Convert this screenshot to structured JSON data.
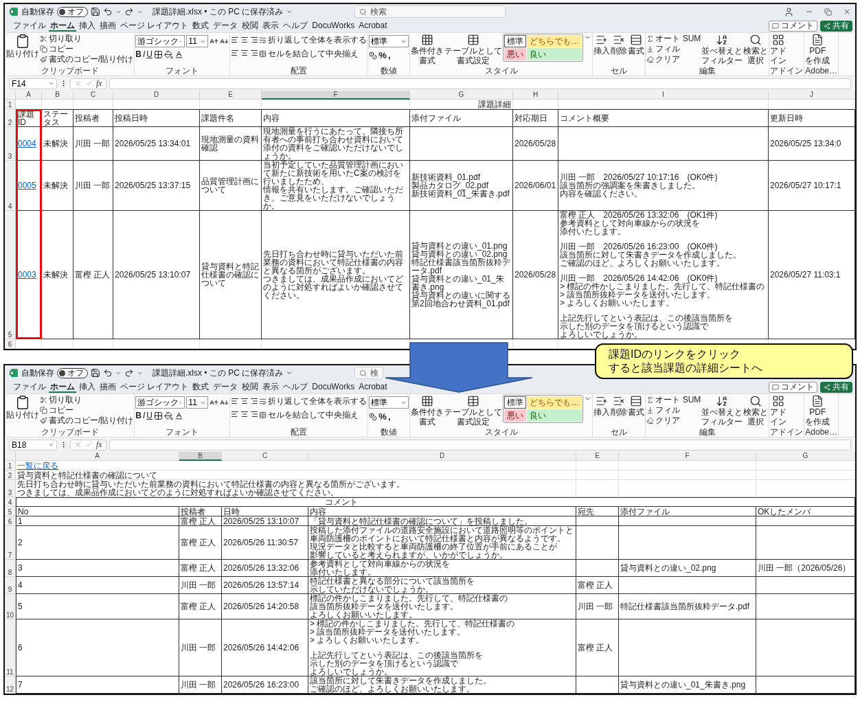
{
  "windows": [
    {
      "titlebar": {
        "autosave": "自動保存",
        "toggle": {
          "label": "オフ",
          "on": false
        },
        "filename": "課題詳細.xlsx • この PC に保存済み",
        "search": "検索",
        "controls_visible": true
      },
      "tabs": [
        {
          "label": "ファイル",
          "selected": false
        },
        {
          "label": "ホーム",
          "selected": true
        },
        {
          "label": "挿入",
          "selected": false
        },
        {
          "label": "描画",
          "selected": false
        },
        {
          "label": "ページ レイアウト",
          "selected": false
        },
        {
          "label": "数式",
          "selected": false
        },
        {
          "label": "データ",
          "selected": false
        },
        {
          "label": "校閲",
          "selected": false
        },
        {
          "label": "表示",
          "selected": false
        },
        {
          "label": "ヘルプ",
          "selected": false
        },
        {
          "label": "DocuWorks",
          "selected": false
        },
        {
          "label": "Acrobat",
          "selected": false
        }
      ],
      "tab_buttons": {
        "comment": "コメント",
        "share": "共有"
      },
      "ribbon": [
        {
          "kind": "clipboard",
          "label": "クリップボード",
          "paste": "貼り付け",
          "items": [
            "切り取り",
            "コピー",
            "書式のコピー/貼り付け"
          ]
        },
        {
          "kind": "font",
          "label": "フォント",
          "font": "游ゴシック",
          "size": "11",
          "styles": [
            "B",
            "I",
            "U"
          ]
        },
        {
          "kind": "align",
          "label": "配置",
          "items": [
            "折り返して全体を表示する",
            "セルを結合して中央揃え"
          ]
        },
        {
          "kind": "number",
          "label": "数値",
          "format": "標準",
          "symbols": [
            "%",
            ","
          ]
        },
        {
          "kind": "styles",
          "label": "スタイル",
          "buttons": [
            [
              "条件付き",
              "書式"
            ],
            [
              "テーブルとして",
              "書式設定"
            ]
          ],
          "cells": [
            {
              "text": "標準",
              "kind": "normal"
            },
            {
              "text": "どちらでも…",
              "kind": "neutral"
            },
            {
              "text": "悪い",
              "kind": "bad"
            },
            {
              "text": "良い",
              "kind": "good"
            }
          ]
        },
        {
          "kind": "cells",
          "label": "セル",
          "buttons": [
            [
              "挿入"
            ],
            [
              "削除"
            ],
            [
              "書式"
            ]
          ]
        },
        {
          "kind": "edit",
          "label": "編集",
          "items": [
            "オート SUM",
            "フィル",
            "クリア"
          ],
          "buttons": [
            [
              "並べ替えと",
              "フィルター"
            ],
            [
              "検索と",
              "選択"
            ]
          ]
        },
        {
          "kind": "addins",
          "label": "アドイン",
          "buttons": [
            [
              "アド",
              "イン"
            ]
          ]
        },
        {
          "kind": "pdf",
          "label": "Adobe…",
          "buttons": [
            [
              "PDF",
              "を作成"
            ]
          ]
        }
      ],
      "formula": {
        "name_box": "F14",
        "fx": "fx"
      },
      "sheet": {
        "kind": "list",
        "columns": [
          {
            "letter": "A",
            "selected": false
          },
          {
            "letter": "B",
            "selected": false
          },
          {
            "letter": "C",
            "selected": false
          },
          {
            "letter": "D",
            "selected": false
          },
          {
            "letter": "E",
            "selected": false
          },
          {
            "letter": "F",
            "selected": true
          },
          {
            "letter": "G",
            "selected": false
          },
          {
            "letter": "H",
            "selected": false
          },
          {
            "letter": "I",
            "selected": false
          },
          {
            "letter": "J",
            "selected": false
          }
        ],
        "rows": [
          {
            "num": "1",
            "kind": "caption",
            "cells": [
              {},
              {},
              {},
              {},
              {},
              {},
              {
                "text": "課題詳細"
              },
              {},
              {},
              {}
            ]
          },
          {
            "num": "2",
            "kind": "header",
            "cells": [
              {
                "text": "課題ID",
                "highlighted": true
              },
              {
                "text": "ステータス"
              },
              {
                "text": "投稿者"
              },
              {
                "text": "投稿日時"
              },
              {
                "text": "課題件名"
              },
              {
                "text": "内容"
              },
              {
                "text": "添付ファイル"
              },
              {
                "text": "対応期日"
              },
              {
                "text": "コメント概要"
              },
              {
                "text": "更新日時"
              }
            ]
          },
          {
            "num": "3",
            "kind": "data",
            "cells": [
              {
                "text": "0004",
                "kind": "link",
                "highlighted": true
              },
              {
                "text": "未解決"
              },
              {
                "text": "川田 一郎"
              },
              {
                "text": "2026/05/25 13:34:01"
              },
              {
                "text": "現地測量の資料確認"
              },
              {
                "lines": [
                  "現地測量を行うにあたって、隣接ち所有者への事前打ち合わせ資料において",
                  "添付の資料をご確認いただけないでしょうか。"
                ]
              },
              {},
              {
                "text": "2026/05/28"
              },
              {},
              {
                "text": "2026/05/25 13:34:0"
              }
            ]
          },
          {
            "num": "4",
            "kind": "data",
            "cells": [
              {
                "text": "0005",
                "kind": "link",
                "highlighted": true
              },
              {
                "text": "未解決"
              },
              {
                "text": "川田 一郎"
              },
              {
                "text": "2026/05/25 13:37:15"
              },
              {
                "text": "品質管理計画について"
              },
              {
                "lines": [
                  "当初予定していた品質管理計画において新たに新技術を用いたC案の検討を行いましたため、",
                  "情報を共有いたします。ご確認いただき、ご意見をいただけないでしょうか。"
                ]
              },
              {
                "lines": [
                  "新技術資料_01.pdf",
                  "製品カタログ_02.pdf",
                  "新技術資料_01_朱書き.pdf"
                ]
              },
              {
                "text": "2026/06/01"
              },
              {
                "lines": [
                  "川田 一郎　2026/05/27 10:17:16　(OK0件)",
                  "該当箇所の強調案を朱書きしました。",
                  "内容を確認ください。"
                ]
              },
              {
                "text": "2026/05/27 10:17:1"
              }
            ]
          },
          {
            "num": "5",
            "kind": "data",
            "cells": [
              {
                "text": "0003",
                "kind": "link",
                "highlighted": true
              },
              {
                "text": "未解決"
              },
              {
                "text": "富樫 正人"
              },
              {
                "text": "2026/05/25 13:10:07"
              },
              {
                "text": "貸与資料と特記仕様書の確認について"
              },
              {
                "lines": [
                  "先日打ち合わせ時に貸与いただいた前業務の資料において特記仕様書の内容と異なる箇所がございます。",
                  "つきましては、成果品作成においてどのように対処すればよいか確認させてください。"
                ]
              },
              {
                "lines": [
                  "貸与資料との違い_01.png",
                  "貸与資料との違い_02.png",
                  "特記仕様書該当箇所抜粋データ.pdf",
                  "貸与資料との違い_01_朱書き.png",
                  "貸与資料との違いに関する第2回地合わせ資料_01.pdf"
                ]
              },
              {
                "text": "2026/05/28"
              },
              {
                "paragraphs": [
                  [
                    "富樫 正人　2026/05/26 13:32:06　(OK1件)",
                    "参考資料として対向車線からの状況を",
                    "添付いたします。"
                  ],
                  [
                    "川田 一郎　2026/05/26 16:23:00　(OK0件)",
                    "該当箇所に対して朱書きデータを作成しました。",
                    "ご確認のほど、よろしくお願いいたします。"
                  ],
                  [
                    "川田 一郎　2026/05/26 14:42:06　(OK0件)",
                    "> 標記の件かしこまりました。先行して、特記仕様書の",
                    "> 該当箇所抜粋データを送付いたします。",
                    "> よろしくお願いいたします。"
                  ],
                  [
                    "上記先行してという表記は、この後該当箇所を",
                    "示した別のデータを頂けるという認識で",
                    "よろしいでしょうか。"
                  ]
                ]
              },
              {
                "text": "2026/05/27 11:03:1"
              }
            ]
          },
          {
            "num": "6",
            "kind": "plain",
            "cells": [
              {},
              {},
              {},
              {},
              {},
              {},
              {},
              {},
              {},
              {}
            ]
          }
        ]
      }
    },
    {
      "titlebar": {
        "autosave": "自動保存",
        "toggle": {
          "label": "オフ",
          "on": false
        },
        "filename": "課題詳細.xlsx • この PC に保存済み",
        "search": "検"
      },
      "tabs": [
        {
          "label": "ファイル",
          "selected": false
        },
        {
          "label": "ホーム",
          "selected": true
        },
        {
          "label": "挿入",
          "selected": false
        },
        {
          "label": "描画",
          "selected": false
        },
        {
          "label": "ページ レイアウト",
          "selected": false
        },
        {
          "label": "数式",
          "selected": false
        },
        {
          "label": "データ",
          "selected": false
        },
        {
          "label": "校閲",
          "selected": false
        },
        {
          "label": "表示",
          "selected": false
        },
        {
          "label": "ヘルプ",
          "selected": false
        },
        {
          "label": "DocuWorks",
          "selected": false
        },
        {
          "label": "Acrobat",
          "selected": false
        }
      ],
      "tab_buttons": {
        "comment": "コメント",
        "share": "共有"
      },
      "ribbon": [
        {
          "kind": "clipboard",
          "label": "クリップボード",
          "paste": "貼り付け",
          "items": [
            "切り取り",
            "コピー",
            "書式のコピー/貼り付け"
          ]
        },
        {
          "kind": "font",
          "label": "フォント",
          "font": "游ゴシック",
          "size": "11",
          "styles": [
            "B",
            "I",
            "U"
          ]
        },
        {
          "kind": "align",
          "label": "配置",
          "items": [
            "折り返して全体を表示する",
            "セルを結合して中央揃え"
          ]
        },
        {
          "kind": "number",
          "label": "数値",
          "format": "標準",
          "symbols": [
            "%",
            ","
          ]
        },
        {
          "kind": "styles",
          "label": "スタイル",
          "buttons": [
            [
              "条件付き",
              "書式"
            ],
            [
              "テーブルとして",
              "書式設定"
            ]
          ],
          "cells": [
            {
              "text": "標準",
              "kind": "normal"
            },
            {
              "text": "どちらでも…",
              "kind": "neutral"
            },
            {
              "text": "悪い",
              "kind": "bad"
            },
            {
              "text": "良い",
              "kind": "good"
            }
          ]
        },
        {
          "kind": "cells",
          "label": "セル",
          "buttons": [
            [
              "挿入"
            ],
            [
              "削除"
            ],
            [
              "書式"
            ]
          ]
        },
        {
          "kind": "edit",
          "label": "編集",
          "items": [
            "オート SUM",
            "フィル",
            "クリア"
          ],
          "buttons": [
            [
              "並べ替えと",
              "フィルター"
            ],
            [
              "検索と",
              "選択"
            ]
          ]
        },
        {
          "kind": "addins",
          "label": "アドイン",
          "buttons": [
            [
              "アド",
              "イン"
            ]
          ]
        },
        {
          "kind": "pdf",
          "label": "Adobe…",
          "buttons": [
            [
              "PDF",
              "を作成"
            ]
          ]
        }
      ],
      "formula": {
        "name_box": "B18",
        "fx": "fx"
      },
      "sheet": {
        "kind": "detail",
        "columns": [
          {
            "letter": "A",
            "selected": false
          },
          {
            "letter": "B",
            "selected": true
          },
          {
            "letter": "C",
            "selected": false
          },
          {
            "letter": "D",
            "selected": false
          },
          {
            "letter": "E",
            "selected": false
          },
          {
            "letter": "F",
            "selected": false
          },
          {
            "letter": "G",
            "selected": false
          }
        ],
        "rows": [
          {
            "num": "1",
            "kind": "plain",
            "cells": [
              {
                "text": "一覧に戻る",
                "kind": "link"
              },
              {
                "merged": true
              },
              {
                "merged": true
              },
              {
                "merged": true
              },
              {},
              {},
              {}
            ]
          },
          {
            "num": "2",
            "kind": "plain",
            "cells": [
              {
                "text": "貸与資料と特記仕様書の確認について"
              },
              {
                "merged": true
              },
              {
                "merged": true
              },
              {
                "merged": true
              },
              {},
              {},
              {}
            ]
          },
          {
            "num": "3",
            "kind": "plain",
            "cells": [
              {
                "lines": [
                  "先日打ち合わせ時に貸与いただいた前業務の資料において特記仕様書の内容と異なる箇所がございます。",
                  "つきましては、成果品作成においてどのように対処すればよいか確認させてください。"
                ]
              },
              {
                "merged": true
              },
              {
                "merged": true
              },
              {
                "merged": true
              },
              {},
              {},
              {}
            ]
          },
          {
            "num": "4",
            "kind": "section",
            "cells": [
              {},
              {},
              {},
              {
                "text": "コメント"
              },
              {},
              {},
              {}
            ]
          },
          {
            "num": "5",
            "kind": "header",
            "cells": [
              {
                "text": "No"
              },
              {
                "text": "投稿者"
              },
              {
                "text": "日時"
              },
              {
                "text": "内容"
              },
              {
                "text": "宛先"
              },
              {
                "text": "添付ファイル"
              },
              {
                "text": "OKしたメンバ"
              }
            ]
          },
          {
            "num": "6",
            "kind": "data",
            "cells": [
              {
                "text": "1"
              },
              {
                "text": "富樫 正人"
              },
              {
                "text": "2026/05/25 13:10:07"
              },
              {
                "text": "「貸与資料と特記仕様書の確認について」を投稿しました。"
              },
              {},
              {},
              {}
            ]
          },
          {
            "num": "7",
            "kind": "data",
            "cells": [
              {
                "text": "2"
              },
              {
                "text": "富樫 正人"
              },
              {
                "text": "2026/05/26 11:30:57"
              },
              {
                "lines": [
                  "投稿した添付ファイルの道路安全施設において道路照明等のポイントと",
                  "車両防護柵のポイントにおいて特記仕様書と内容が異なるようです。",
                  "現況データと比較すると車両防護柵の終了位置が手前にあることが",
                  "影響していると考えられますが、いかがでしょうか。"
                ]
              },
              {},
              {},
              {}
            ]
          },
          {
            "num": "8",
            "kind": "data",
            "cells": [
              {
                "text": "3"
              },
              {
                "text": "富樫 正人"
              },
              {
                "text": "2026/05/26 13:32:06"
              },
              {
                "lines": [
                  "参考資料として対向車線からの状況を",
                  "添付いたします。"
                ]
              },
              {},
              {
                "text": "貸与資料との違い_02.png"
              },
              {
                "text": "川田 一郎（2026/05/26）"
              }
            ]
          },
          {
            "num": "9",
            "kind": "data",
            "cells": [
              {
                "text": "4"
              },
              {
                "text": "川田 一郎"
              },
              {
                "text": "2026/05/26 13:57:14"
              },
              {
                "lines": [
                  "特記仕様書と異なる部分について該当箇所を",
                  "示していただけないでしょうか。"
                ]
              },
              {
                "text": "富樫 正人"
              },
              {},
              {}
            ]
          },
          {
            "num": "10",
            "kind": "data",
            "cells": [
              {
                "text": "5"
              },
              {
                "text": "富樫 正人"
              },
              {
                "text": "2026/05/26 14:20:58"
              },
              {
                "lines": [
                  "標記の件かしこまりました。先行して、特記仕様書の",
                  "該当箇所抜粋データを送付いたします。",
                  "よろしくお願いいたします。"
                ]
              },
              {
                "text": "川田 一郎"
              },
              {
                "text": "特記仕様書該当箇所抜粋データ.pdf"
              },
              {}
            ]
          },
          {
            "num": "11",
            "kind": "data",
            "cells": [
              {
                "text": "6"
              },
              {
                "text": "川田 一郎"
              },
              {
                "text": "2026/05/26 14:42:06"
              },
              {
                "paragraphs": [
                  [
                    "> 標記の件かしこまりました。先行して、特記仕様書の",
                    "> 該当箇所抜粋データを送付いたします。",
                    "> よろしくお願いいたします。"
                  ],
                  [
                    "上記先行してという表記は、この後該当箇所を",
                    "示した別のデータを頂けるという認識で",
                    "よろしいでしょうか。"
                  ]
                ]
              },
              {
                "text": "富樫 正人"
              },
              {},
              {}
            ]
          },
          {
            "num": "12",
            "kind": "data",
            "cells": [
              {
                "text": "7"
              },
              {
                "text": "川田 一郎"
              },
              {
                "text": "2026/05/26 16:23:00"
              },
              {
                "lines": [
                  "該当箇所に対して朱書きデータを作成しました。",
                  "ご確認のほど、よろしくお願いいたします。"
                ]
              },
              {},
              {
                "text": "貸与資料との違い_01_朱書き.png"
              },
              {}
            ]
          }
        ]
      }
    }
  ],
  "callout": {
    "lines": [
      "課題IDのリンクをクリック",
      "すると該当課題の詳細シートへ"
    ]
  }
}
